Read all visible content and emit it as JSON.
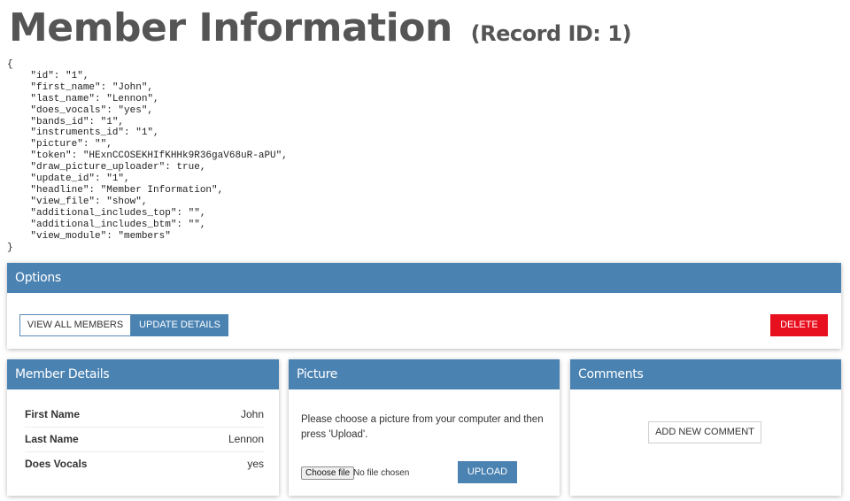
{
  "page": {
    "headline": "Member Information",
    "record_label": "(Record ID: 1)"
  },
  "debug_dump": "{\n    \"id\": \"1\",\n    \"first_name\": \"John\",\n    \"last_name\": \"Lennon\",\n    \"does_vocals\": \"yes\",\n    \"bands_id\": \"1\",\n    \"instruments_id\": \"1\",\n    \"picture\": \"\",\n    \"token\": \"HExnCCOSEKHIfKHHk9R36gaV68uR-aPU\",\n    \"draw_picture_uploader\": true,\n    \"update_id\": \"1\",\n    \"headline\": \"Member Information\",\n    \"view_file\": \"show\",\n    \"additional_includes_top\": \"\",\n    \"additional_includes_btm\": \"\",\n    \"view_module\": \"members\"\n}",
  "options": {
    "title": "Options",
    "view_all_label": "VIEW ALL MEMBERS",
    "update_label": "UPDATE DETAILS",
    "delete_label": "DELETE"
  },
  "member_details": {
    "title": "Member Details",
    "rows": [
      {
        "label": "First Name",
        "value": "John"
      },
      {
        "label": "Last Name",
        "value": "Lennon"
      },
      {
        "label": "Does Vocals",
        "value": "yes"
      }
    ]
  },
  "picture": {
    "title": "Picture",
    "instructions": "Please choose a picture from your computer and then press 'Upload'.",
    "choose_file_label": "Choose file",
    "no_file_text": "No file chosen",
    "upload_label": "UPLOAD"
  },
  "comments": {
    "title": "Comments",
    "add_label": "ADD NEW COMMENT"
  },
  "colors": {
    "header_blue": "#4a82b2",
    "danger_red": "#e8101f",
    "headline_gray": "#555555"
  }
}
